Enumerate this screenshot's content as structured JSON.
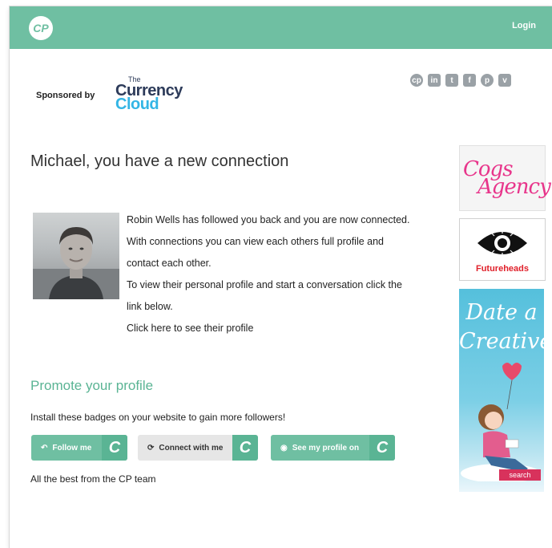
{
  "header": {
    "logo_text": "CP",
    "login_label": "Login"
  },
  "sponsor": {
    "label": "Sponsored by",
    "logo_the": "The",
    "logo_currency": "Currency",
    "logo_cloud": "Cloud"
  },
  "social_icons": [
    "cp-icon",
    "linkedin-icon",
    "twitter-icon",
    "facebook-icon",
    "pinterest-icon",
    "vimeo-icon"
  ],
  "social_glyphs": [
    "cp",
    "in",
    "t",
    "f",
    "p",
    "v"
  ],
  "content": {
    "headline": "Michael, you have a new connection",
    "paragraphs": [
      "Robin Wells has followed you back and you are now connected.",
      "With connections you can view each others full profile and",
      "contact each other.",
      "To view their personal profile and start a conversation click the",
      "link below."
    ],
    "profile_link": "Click here to see their profile"
  },
  "promote": {
    "title": "Promote your profile",
    "description": "Install these badges on your website to gain more followers!",
    "badges": [
      {
        "label": "Follow me",
        "style": "green"
      },
      {
        "label": "Connect with me",
        "style": "grey"
      },
      {
        "label": "See my profile on",
        "style": "green"
      }
    ],
    "signoff": "All the best from the CP team"
  },
  "ads": {
    "cogs_line1": "Cogs",
    "cogs_line2": "Agency",
    "futureheads": "Futureheads",
    "date_line1": "Date a",
    "date_line2": "Creative",
    "date_button": "search"
  },
  "colors": {
    "brand": "#6fbfa2",
    "brand_dark": "#5ab494",
    "cogs_pink": "#e8358b",
    "futureheads_red": "#e0202a"
  }
}
